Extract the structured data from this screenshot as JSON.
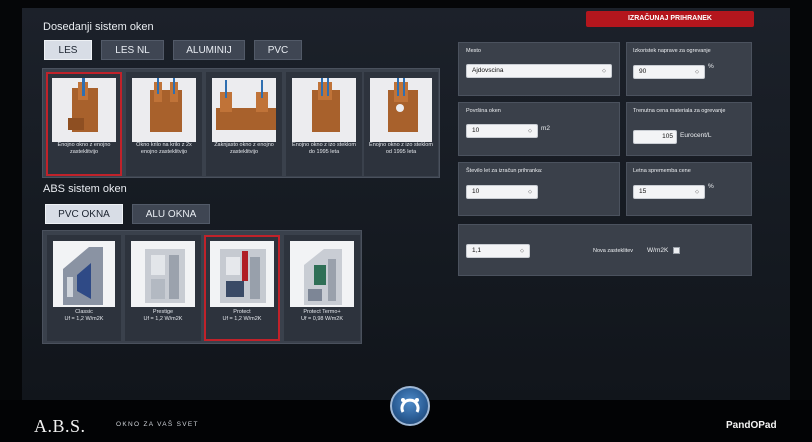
{
  "top": {
    "title": "Dosedanji sistem oken",
    "tabs": [
      {
        "label": "LES",
        "active": true
      },
      {
        "label": "LES NL",
        "active": false
      },
      {
        "label": "ALUMINIJ",
        "active": false
      },
      {
        "label": "PVC",
        "active": false
      }
    ],
    "cards": [
      {
        "caption": "Enojno okno z enojno zasteklitvijo",
        "selected": true
      },
      {
        "caption": "Okno krilo na krilo z 2x enojno zasteklitvijo",
        "selected": false
      },
      {
        "caption": "Zaknjasto okno z enojno zasteklitvijo",
        "selected": false
      },
      {
        "caption": "Enojno okno z izo steklom do 1995 leta",
        "selected": false
      },
      {
        "caption": "Enojno okno z izo steklom od 1995 leta",
        "selected": false
      }
    ]
  },
  "abs": {
    "title": "ABS sistem oken",
    "tabs": [
      {
        "label": "PVC OKNA",
        "active": true
      },
      {
        "label": "ALU OKNA",
        "active": false
      }
    ],
    "cards": [
      {
        "name": "Classic",
        "value": "Uf = 1,2 W/m2K",
        "selected": false
      },
      {
        "name": "Prestige",
        "value": "Uf = 1,2 W/m2K",
        "selected": false
      },
      {
        "name": "Protect",
        "value": "Uf = 1,2 W/m2K",
        "selected": true
      },
      {
        "name": "Protect Termo+",
        "value": "Uf = 0,98 W/m2K",
        "selected": false
      }
    ]
  },
  "calculator": {
    "button_label": "IZRAČUNAJ PRIHRANEK",
    "mesto": {
      "label": "Mesto",
      "value": "Ajdovscina"
    },
    "izkoristek": {
      "label": "Izkoristek naprave za ogrevanje",
      "value": "90",
      "unit": "%"
    },
    "povrsina": {
      "label": "Površina oken",
      "value": "10",
      "unit": "m2"
    },
    "cena": {
      "label": "Trenutna cena materiala za ogrevanje",
      "value": "105",
      "unit": "Eurocent/L"
    },
    "stevilo_let": {
      "label": "Število let za izračun prihranka:",
      "value": "10"
    },
    "letna_sprememba": {
      "label": "Letna sprememba cene",
      "value": "15",
      "unit": "%"
    },
    "u_value": {
      "value": "1,1"
    },
    "nova": {
      "label": "Nova zasteklitev",
      "unit": "W/m2K"
    }
  },
  "footer": {
    "brand": "A.B.S.",
    "tagline": "OKNO ZA VAŠ SVET",
    "right_logo": "PandOPad"
  },
  "colors": {
    "accent_red": "#c0222a",
    "home_blue": "#3a72b0",
    "wood": "#a8612c"
  },
  "icons": {
    "home": "horseshoe-icon",
    "dropdown": "chevron-updown-icon"
  }
}
